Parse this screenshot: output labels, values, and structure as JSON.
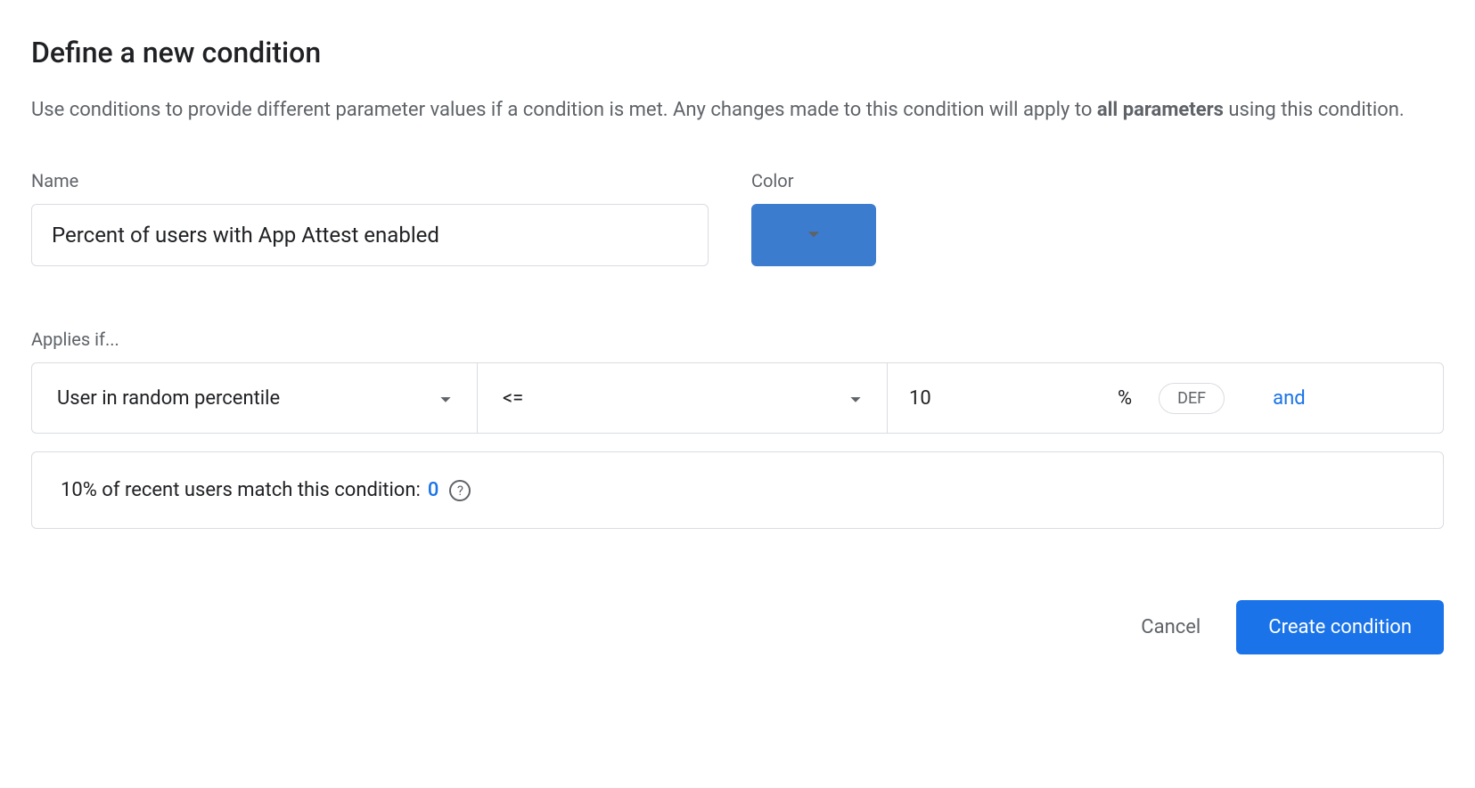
{
  "title": "Define a new condition",
  "description": {
    "prefix": "Use conditions to provide different parameter values if a condition is met. Any changes made to this condition will apply to ",
    "bold": "all parameters",
    "suffix": " using this condition."
  },
  "fields": {
    "name_label": "Name",
    "name_value": "Percent of users with App Attest enabled",
    "color_label": "Color",
    "color_value": "#3c7ccf"
  },
  "applies": {
    "label": "Applies if...",
    "condition_type": "User in random percentile",
    "operator": "<=",
    "value": "10",
    "percent": "%",
    "seed": "DEF",
    "and": "and"
  },
  "match": {
    "text": "10% of recent users match this condition: ",
    "count": "0"
  },
  "actions": {
    "cancel": "Cancel",
    "create": "Create condition"
  }
}
